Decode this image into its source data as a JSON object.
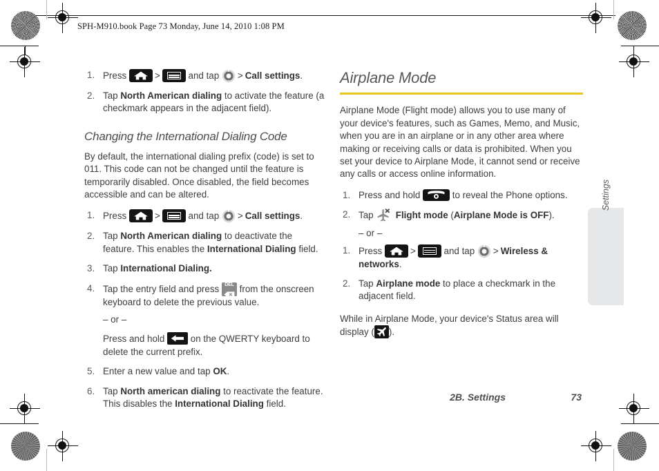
{
  "page": {
    "header_text": "SPH-M910.book  Page 73  Monday, June 14, 2010  1:08 PM",
    "footer_chapter": "2B. Settings",
    "footer_page_number": "73",
    "side_tab_label": "Settings",
    "accent_rule_color": "#e8c81e",
    "side_tab_color": "#e6e7e8"
  },
  "left_column": {
    "steps_top": [
      {
        "parts": [
          {
            "t": "text",
            "v": "Press "
          },
          {
            "t": "icon",
            "v": "home-key-icon"
          },
          {
            "t": "text",
            "v": " > "
          },
          {
            "t": "icon",
            "v": "menu-key-icon"
          },
          {
            "t": "text",
            "v": " and tap "
          },
          {
            "t": "icon",
            "v": "settings-gear-icon"
          },
          {
            "t": "text",
            "v": " > "
          },
          {
            "t": "bold",
            "v": "Call settings"
          },
          {
            "t": "text",
            "v": "."
          }
        ]
      },
      {
        "parts": [
          {
            "t": "text",
            "v": "Tap "
          },
          {
            "t": "bold",
            "v": "North American dialing"
          },
          {
            "t": "text",
            "v": " to activate the feature (a checkmark appears in the adjacent field)."
          }
        ]
      }
    ],
    "subsection_title": "Changing the International Dialing Code",
    "intro_paragraph": "By default, the international dialing prefix (code) is set to 011. This code can not be changed until the feature is temporarily disabled. Once disabled, the field becomes accessible and can be altered.",
    "steps_main": [
      {
        "parts": [
          {
            "t": "text",
            "v": "Press "
          },
          {
            "t": "icon",
            "v": "home-key-icon"
          },
          {
            "t": "text",
            "v": " > "
          },
          {
            "t": "icon",
            "v": "menu-key-icon"
          },
          {
            "t": "text",
            "v": " and tap "
          },
          {
            "t": "icon",
            "v": "settings-gear-icon"
          },
          {
            "t": "text",
            "v": " > "
          },
          {
            "t": "bold",
            "v": "Call settings"
          },
          {
            "t": "text",
            "v": "."
          }
        ]
      },
      {
        "parts": [
          {
            "t": "text",
            "v": "Tap "
          },
          {
            "t": "bold",
            "v": "North American dialing"
          },
          {
            "t": "text",
            "v": " to deactivate the feature. This enables the "
          },
          {
            "t": "bold",
            "v": "International Dialing"
          },
          {
            "t": "text",
            "v": " field."
          }
        ]
      },
      {
        "parts": [
          {
            "t": "text",
            "v": "Tap "
          },
          {
            "t": "bold",
            "v": "International Dialing."
          }
        ]
      },
      {
        "parts": [
          {
            "t": "text",
            "v": "Tap the entry field and press "
          },
          {
            "t": "icon",
            "v": "del-key-icon"
          },
          {
            "t": "text",
            "v": " from the onscreen keyboard to delete the previous value."
          }
        ],
        "or_separator": "– or –",
        "alt_parts": [
          {
            "t": "text",
            "v": "Press and hold "
          },
          {
            "t": "icon",
            "v": "backspace-key-icon"
          },
          {
            "t": "text",
            "v": " on the QWERTY keyboard to delete the current prefix."
          }
        ]
      },
      {
        "parts": [
          {
            "t": "text",
            "v": "Enter a new value and tap "
          },
          {
            "t": "bold",
            "v": "OK"
          },
          {
            "t": "text",
            "v": "."
          }
        ]
      },
      {
        "parts": [
          {
            "t": "text",
            "v": "Tap "
          },
          {
            "t": "bold",
            "v": "North american dialing"
          },
          {
            "t": "text",
            "v": " to reactivate the feature. This disables the "
          },
          {
            "t": "bold",
            "v": "International Dialing"
          },
          {
            "t": "text",
            "v": " field."
          }
        ]
      }
    ]
  },
  "right_column": {
    "section_title": "Airplane Mode",
    "intro_paragraph": "Airplane Mode (Flight mode) allows you to use many of your device's features, such as Games, Memo, and Music, when you are in an airplane or in any other area where making or receiving calls or data is prohibited. When you set your device to Airplane Mode, it cannot send or receive any calls or access online information.",
    "steps_a": [
      {
        "parts": [
          {
            "t": "text",
            "v": "Press and hold "
          },
          {
            "t": "icon",
            "v": "power-key-icon"
          },
          {
            "t": "text",
            "v": " to reveal the Phone options."
          }
        ]
      },
      {
        "parts": [
          {
            "t": "text",
            "v": "Tap "
          },
          {
            "t": "icon",
            "v": "flight-mode-icon"
          },
          {
            "t": "text",
            "v": "  "
          },
          {
            "t": "bold",
            "v": "Flight mode"
          },
          {
            "t": "text",
            "v": " ("
          },
          {
            "t": "bold",
            "v": "Airplane Mode is OFF"
          },
          {
            "t": "text",
            "v": ")."
          }
        ],
        "or_separator": "– or –"
      }
    ],
    "steps_b": [
      {
        "parts": [
          {
            "t": "text",
            "v": "Press "
          },
          {
            "t": "icon",
            "v": "home-key-icon"
          },
          {
            "t": "text",
            "v": " > "
          },
          {
            "t": "icon",
            "v": "menu-key-icon"
          },
          {
            "t": "text",
            "v": " and tap "
          },
          {
            "t": "icon",
            "v": "settings-gear-icon"
          },
          {
            "t": "text",
            "v": " > "
          },
          {
            "t": "bold",
            "v": "Wireless & networks"
          },
          {
            "t": "text",
            "v": "."
          }
        ]
      },
      {
        "parts": [
          {
            "t": "text",
            "v": "Tap "
          },
          {
            "t": "bold",
            "v": "Airplane mode"
          },
          {
            "t": "text",
            "v": " to place a checkmark in the adjacent field."
          }
        ]
      }
    ],
    "closing_paragraph_before": "While in Airplane Mode, your device's Status area will display (",
    "closing_icon": "airplane-status-icon",
    "closing_paragraph_after": ")."
  }
}
